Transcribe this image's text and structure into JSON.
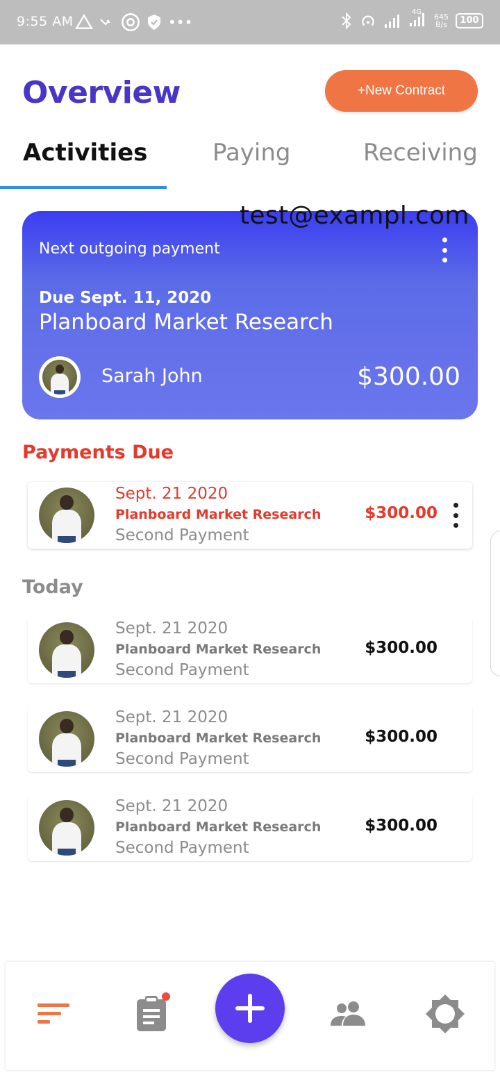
{
  "status_bar": {
    "time": "9:55 AM",
    "net_type": "4G",
    "net_speed_value": "645",
    "net_speed_unit": "B/s",
    "battery": "100",
    "left_icons": [
      "warning-triangle-icon",
      "missed-call-icon",
      "app-icon",
      "shield-icon",
      "more-dots-icon"
    ],
    "right_icons": [
      "bluetooth-icon",
      "hotspot-icon",
      "signal-icon",
      "signal-icon",
      "battery-icon"
    ]
  },
  "header": {
    "title": "Overview",
    "new_contract_label": "+New Contract"
  },
  "tabs": [
    {
      "label": "Activities",
      "active": true
    },
    {
      "label": "Paying",
      "active": false
    },
    {
      "label": "Receiving",
      "active": false
    }
  ],
  "overlay_email": "test@exampl.com",
  "next_payment": {
    "label": "Next outgoing payment",
    "due": "Due Sept. 11, 2020",
    "title": "Planboard Market Research",
    "person": "Sarah John",
    "amount": "$300.00"
  },
  "sections": {
    "due_title": "Payments Due",
    "today_title": "Today"
  },
  "payments_due": [
    {
      "date": "Sept. 21 2020",
      "title": "Planboard Market Research",
      "subtitle": "Second Payment",
      "amount": "$300.00"
    }
  ],
  "today": [
    {
      "date": "Sept. 21 2020",
      "title": "Planboard Market Research",
      "subtitle": "Second Payment",
      "amount": "$300.00"
    },
    {
      "date": "Sept. 21 2020",
      "title": "Planboard Market Research",
      "subtitle": "Second Payment",
      "amount": "$300.00"
    },
    {
      "date": "Sept. 21 2020",
      "title": "Planboard Market Research",
      "subtitle": "Second Payment",
      "amount": "$300.00"
    }
  ],
  "bottom_nav": {
    "items": [
      "sort-icon",
      "clipboard-icon",
      "add-icon",
      "people-icon",
      "settings-icon"
    ]
  },
  "colors": {
    "title": "#4a35c9",
    "accent_orange": "#f07545",
    "due_red": "#e5392b",
    "fab": "#5c3eee",
    "tab_indicator": "#2f8fe0"
  }
}
